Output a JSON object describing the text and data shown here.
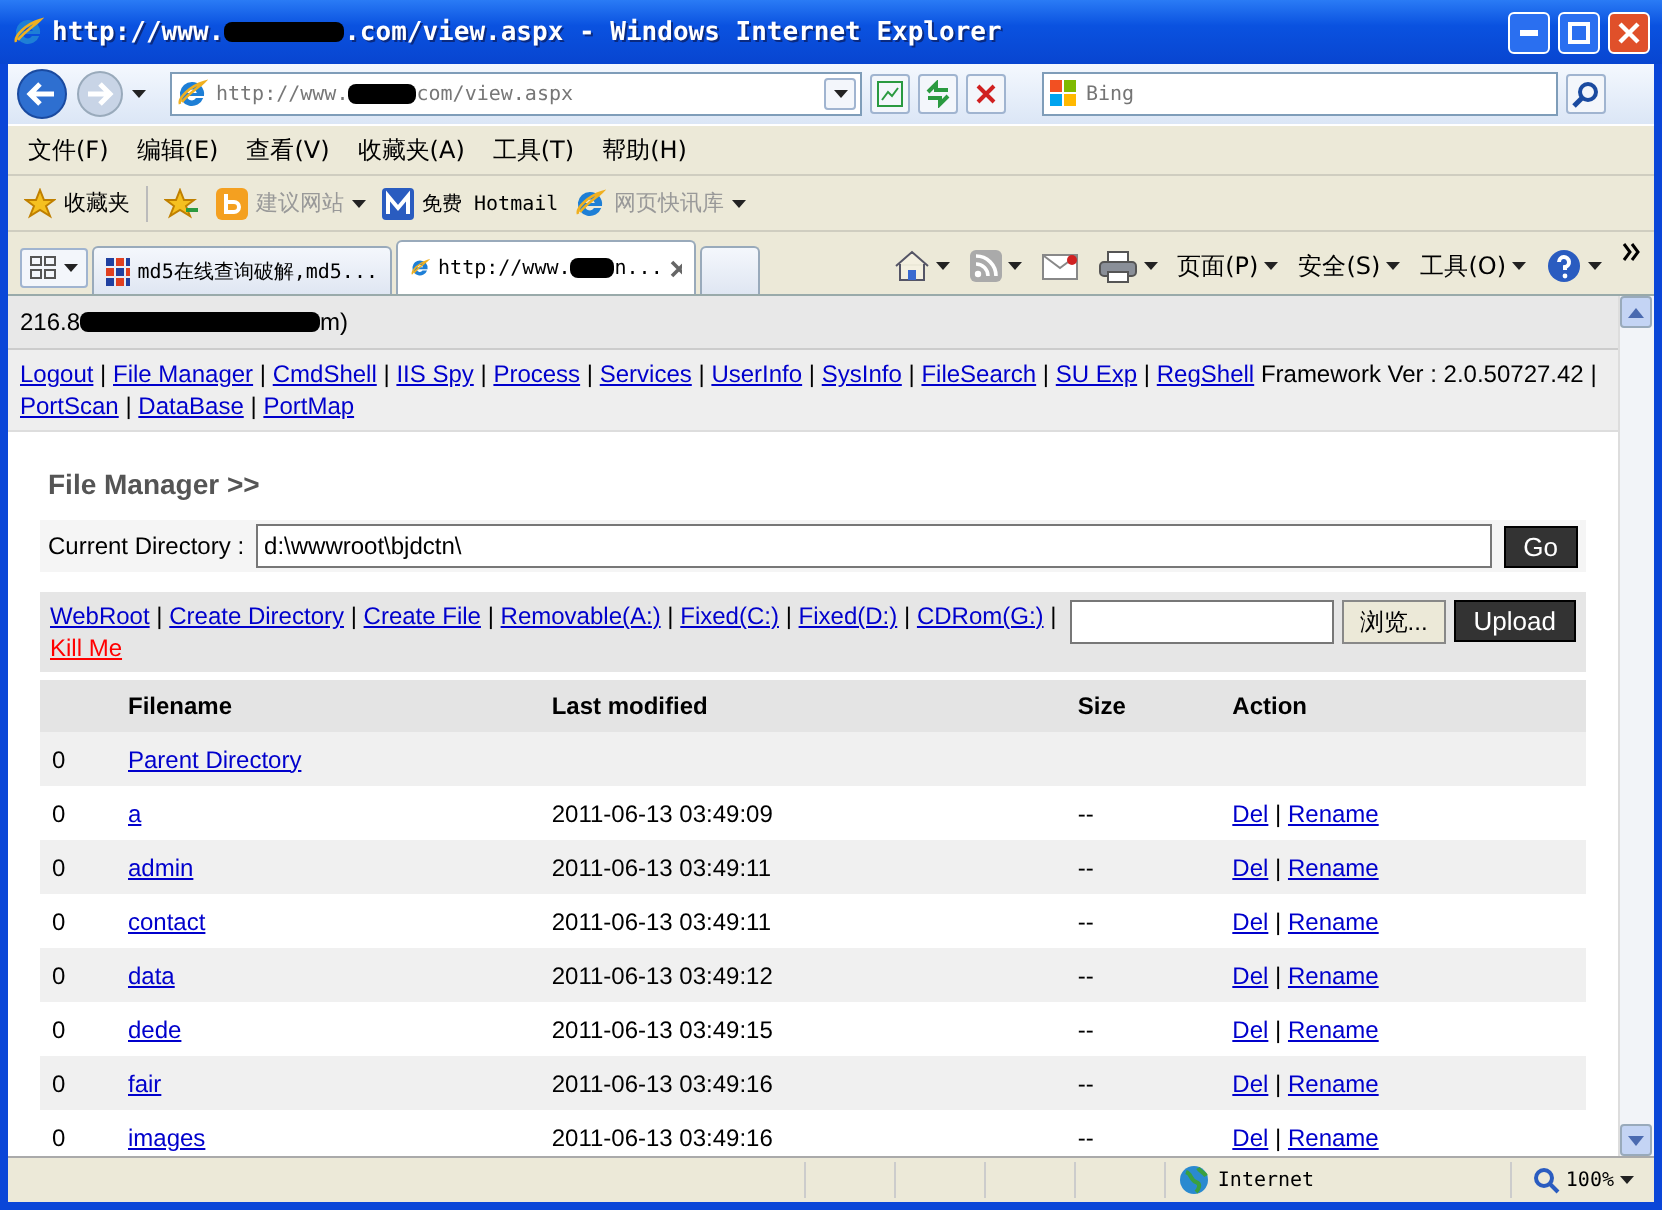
{
  "window": {
    "title_start": "http://www.",
    "title_end": ".com/view.aspx - Windows Internet Explorer"
  },
  "address_bar": {
    "start": "http://www.",
    "end": "com/view.aspx"
  },
  "search": {
    "placeholder": "Bing"
  },
  "menu": [
    "文件(F)",
    "编辑(E)",
    "查看(V)",
    "收藏夹(A)",
    "工具(T)",
    "帮助(H)"
  ],
  "favorites_bar": {
    "title": "收藏夹",
    "items": [
      {
        "label": "建议网站",
        "dimmed": true,
        "kind": "suggest"
      },
      {
        "label": "免费 Hotmail",
        "dimmed": false,
        "kind": "mail"
      },
      {
        "label": "网页快讯库",
        "dimmed": true,
        "kind": "slice"
      }
    ]
  },
  "tabs": [
    {
      "label": "md5在线查询破解,md5...",
      "selected": false,
      "kind": "grid"
    },
    {
      "label": "http://www.",
      "label_end": "n...",
      "selected": true,
      "kind": "ie"
    }
  ],
  "command_bar": [
    "页面(P)",
    "安全(S)",
    "工具(O)"
  ],
  "page": {
    "host_start": "216.8",
    "host_end": "m)",
    "separator": "|",
    "nav_links": [
      "Logout",
      "File Manager",
      "CmdShell",
      "IIS Spy",
      "Process",
      "Services",
      "UserInfo",
      "SysInfo",
      "FileSearch",
      "SU Exp",
      "RegShell"
    ],
    "framework": "Framework Ver : 2.0.50727.42",
    "nav_links_2": [
      "PortScan",
      "DataBase",
      "PortMap"
    ],
    "heading": "File Manager >>",
    "current_directory": {
      "label": "Current Directory :",
      "value": "d:\\wwwroot\\bjdctn\\",
      "button": "Go"
    },
    "drive_links": [
      {
        "label": "WebRoot",
        "kind": "link"
      },
      {
        "label": "Create Directory",
        "kind": "link"
      },
      {
        "label": "Create File",
        "kind": "link"
      },
      {
        "label": "Removable(A:)",
        "kind": "link"
      },
      {
        "label": "Fixed(C:)",
        "kind": "link"
      },
      {
        "label": "Fixed(D:)",
        "kind": "link"
      },
      {
        "label": "CDRom(G:)",
        "kind": "link"
      },
      {
        "label": "Kill Me",
        "kind": "danger"
      }
    ],
    "upload": {
      "browse": "浏览...",
      "button": "Upload"
    },
    "table": {
      "columns": [
        "Filename",
        "Last modified",
        "Size",
        "Action"
      ],
      "rows": [
        {
          "count": "0",
          "name": "Parent Directory"
        },
        {
          "count": "0",
          "name": "a",
          "modified": "2011-06-13 03:49:09",
          "size": "--",
          "actions": [
            "Del",
            "Rename"
          ]
        },
        {
          "count": "0",
          "name": "admin",
          "modified": "2011-06-13 03:49:11",
          "size": "--",
          "actions": [
            "Del",
            "Rename"
          ]
        },
        {
          "count": "0",
          "name": "contact",
          "modified": "2011-06-13 03:49:11",
          "size": "--",
          "actions": [
            "Del",
            "Rename"
          ]
        },
        {
          "count": "0",
          "name": "data",
          "modified": "2011-06-13 03:49:12",
          "size": "--",
          "actions": [
            "Del",
            "Rename"
          ]
        },
        {
          "count": "0",
          "name": "dede",
          "modified": "2011-06-13 03:49:15",
          "size": "--",
          "actions": [
            "Del",
            "Rename"
          ]
        },
        {
          "count": "0",
          "name": "fair",
          "modified": "2011-06-13 03:49:16",
          "size": "--",
          "actions": [
            "Del",
            "Rename"
          ]
        },
        {
          "count": "0",
          "name": "images",
          "modified": "2011-06-13 03:49:16",
          "size": "--",
          "actions": [
            "Del",
            "Rename"
          ]
        }
      ]
    }
  },
  "status_bar": {
    "zone": "Internet",
    "zoom": "100%"
  }
}
